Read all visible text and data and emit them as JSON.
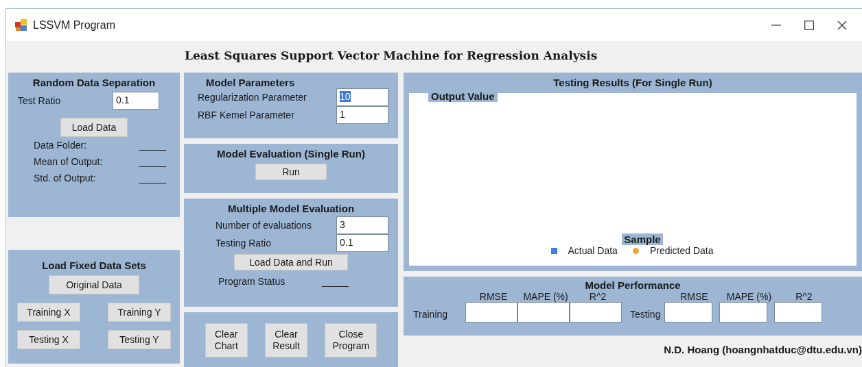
{
  "window": {
    "title": "LSSVM Program"
  },
  "heading": "Least Squares Support Vector Machine for Regression Analysis",
  "random_data_separation": {
    "title": "Random Data Separation",
    "test_ratio": {
      "label": "Test Ratio",
      "value": "0.1"
    },
    "button": "Load Data",
    "info": [
      {
        "label": "Data Folder:",
        "value": "_____"
      },
      {
        "label": "Mean of Output:",
        "value": "_____"
      },
      {
        "label": "Std. of Output:",
        "value": "_____"
      }
    ]
  },
  "load_fixed_data_sets": {
    "title": "Load Fixed Data Sets",
    "buttons": [
      "Original Data",
      "Training X",
      "Training Y",
      "Testing X",
      "Testing Y"
    ]
  },
  "model_parameters": {
    "title": "Model Parameters",
    "fields": [
      {
        "label": "Regularization Parameter",
        "value": "10",
        "text_selected": true
      },
      {
        "label": "RBF Kemel Parameter",
        "value": "1",
        "text_selected": false
      }
    ]
  },
  "single_run": {
    "title": "Model Evaluation (Single Run)",
    "button": "Run"
  },
  "multiple_evaluation": {
    "title": "Multiple Model Evaluation",
    "fields": [
      {
        "label": "Number of evaluations",
        "value": "3"
      },
      {
        "label": "Testing Ratio",
        "value": "0.1"
      }
    ],
    "button": "Load Data and Run",
    "status": {
      "label": "Program Status",
      "value": "_____"
    }
  },
  "actions": [
    "Clear Chart",
    "Clear Result",
    "Close Program"
  ],
  "chart": {
    "title": "Testing Results (For Single Run)",
    "y_title": "Output Value",
    "x_title": "Sample",
    "legend": [
      {
        "label": "Actual Data",
        "color": "#3b82e0",
        "kind": "square"
      },
      {
        "label": "Predicted Data",
        "color": "#f2a43a",
        "kind": "circle"
      }
    ]
  },
  "model_performance": {
    "title": "Model Performance",
    "groups": [
      {
        "label": "Training",
        "columns": [
          "RMSE",
          "MAPE (%)",
          "R^2"
        ]
      },
      {
        "label": "Testing",
        "columns": [
          "RMSE",
          "MAPE (%)",
          "R^2"
        ]
      }
    ]
  },
  "credit": "N.D. Hoang (hoangnhatduc@dtu.edu.vn)"
}
